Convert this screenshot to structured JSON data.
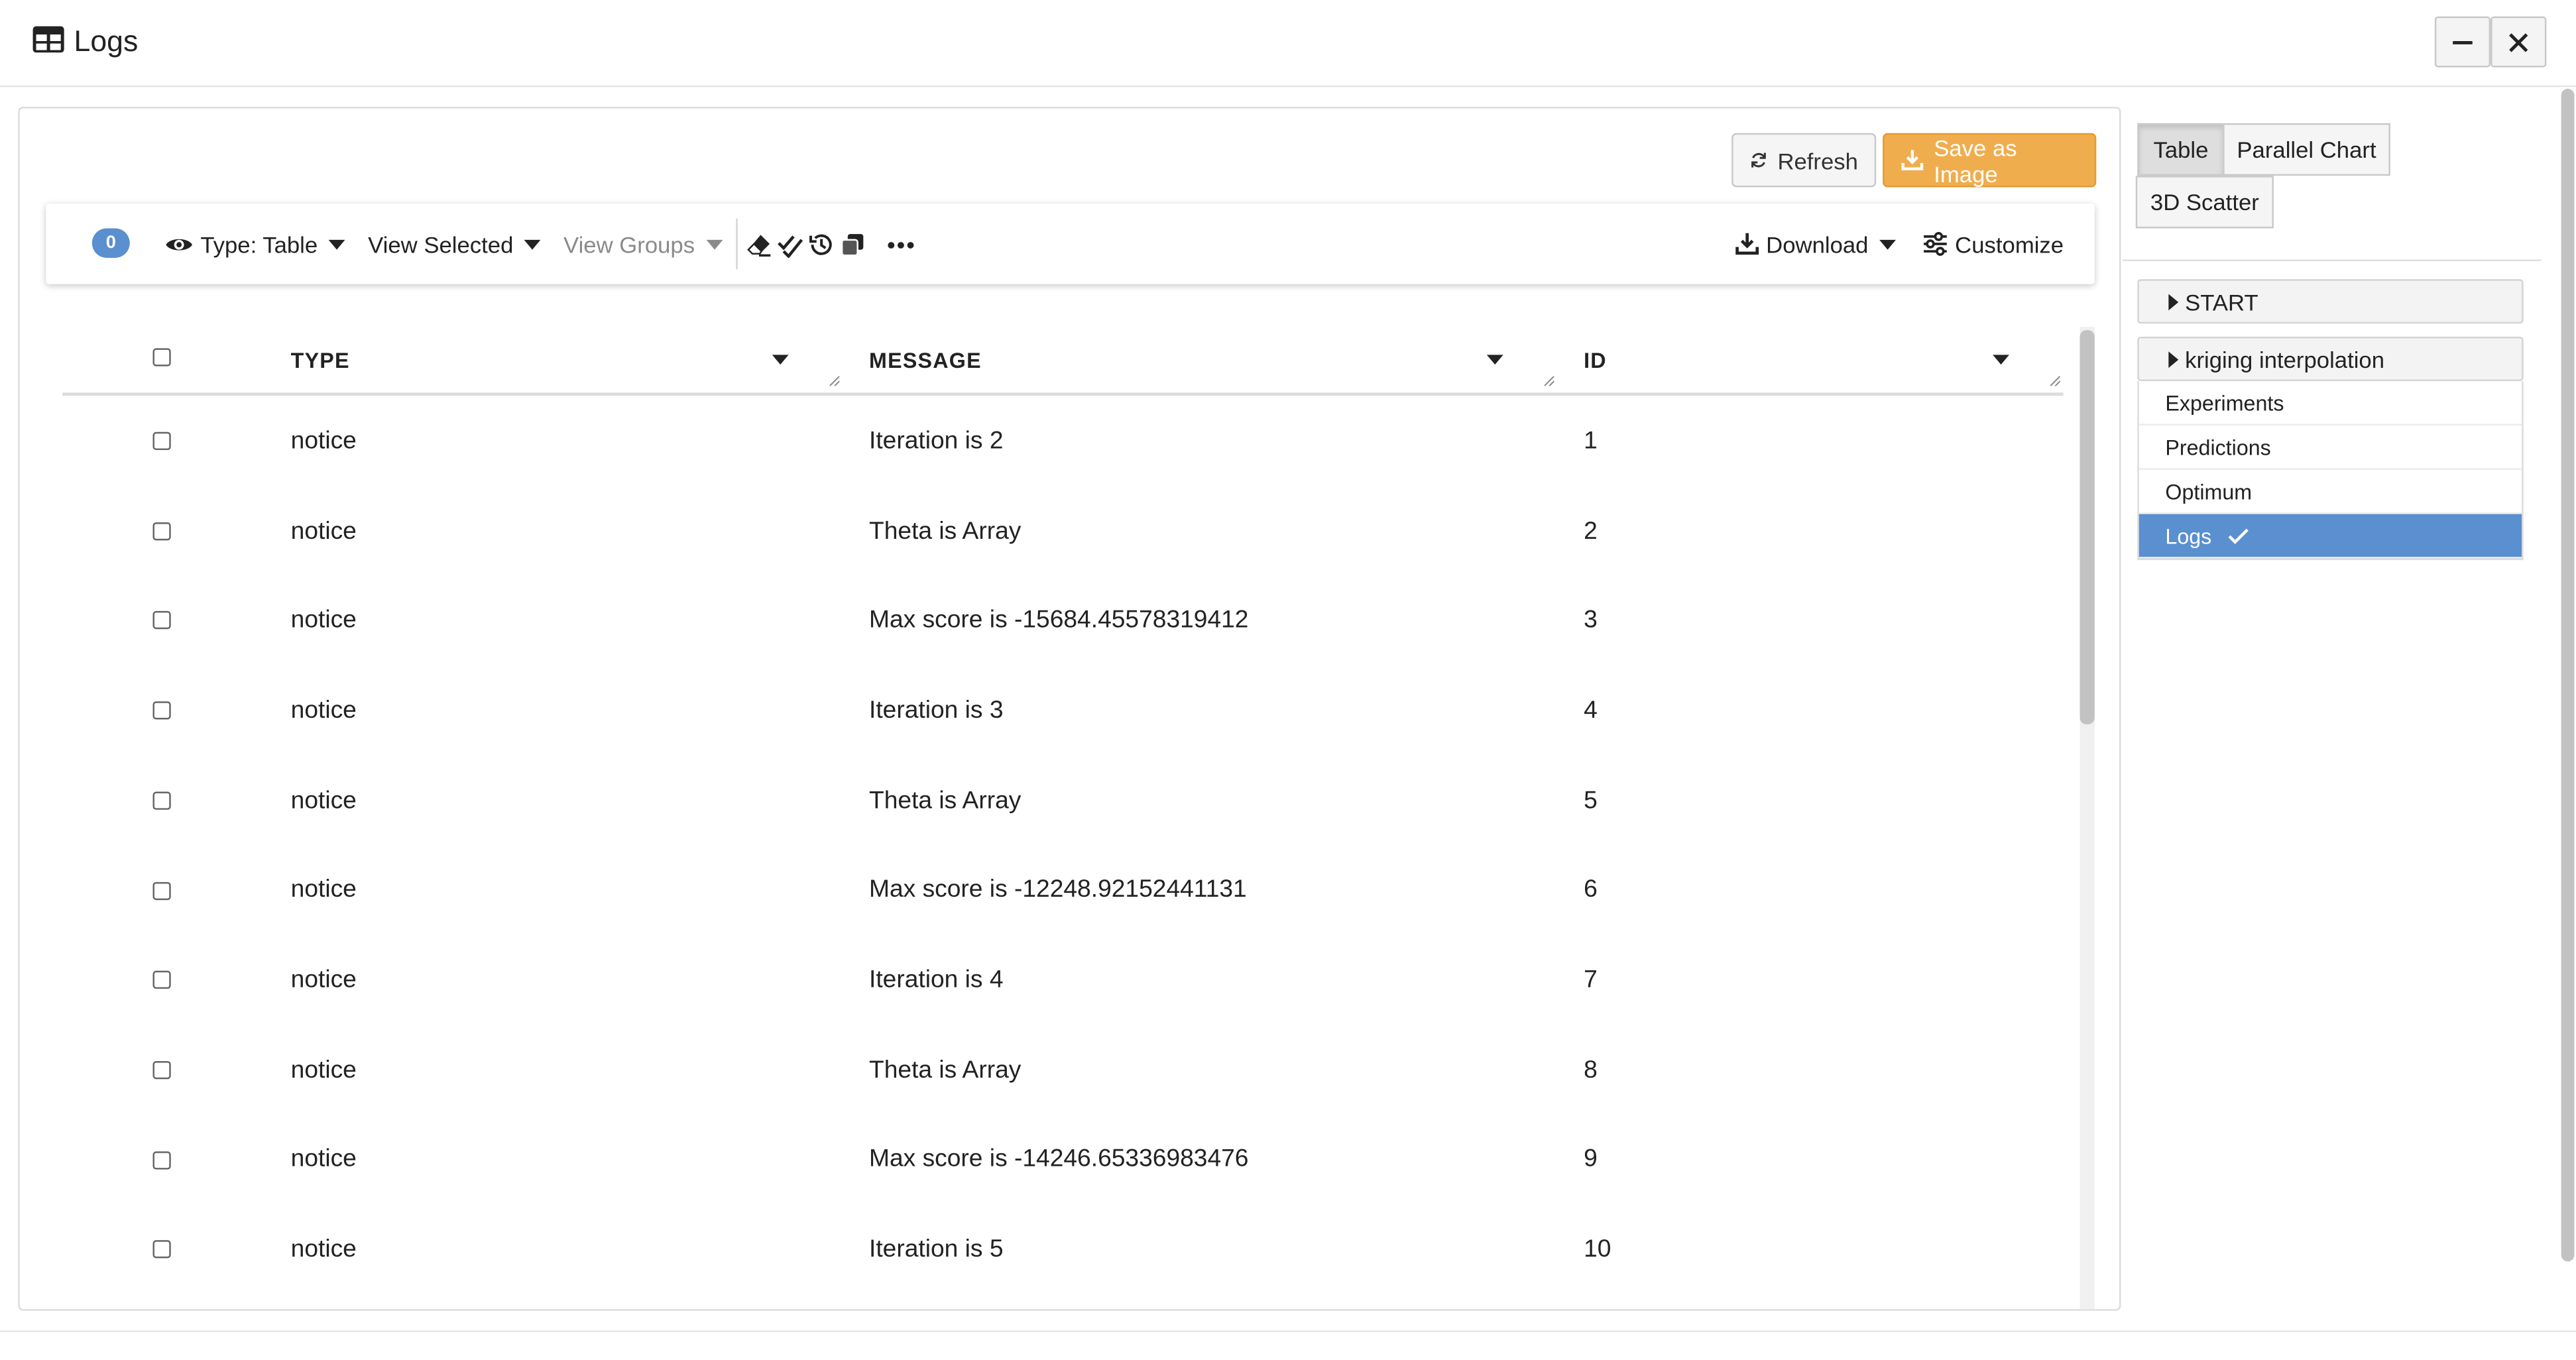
{
  "window": {
    "title": "Logs",
    "minimize_icon": "minus-icon",
    "close_icon": "close-icon"
  },
  "actions": {
    "refresh_label": "Refresh",
    "save_image_label": "Save as Image"
  },
  "toolbar": {
    "selected_count": "0",
    "type_label": "Type: Table",
    "view_selected_label": "View Selected",
    "view_groups_label": "View Groups",
    "download_label": "Download",
    "customize_label": "Customize",
    "more_label": "•••"
  },
  "grid": {
    "columns": [
      "TYPE",
      "MESSAGE",
      "ID"
    ],
    "rows": [
      {
        "type": "notice",
        "message": "Iteration is 2",
        "id": "1"
      },
      {
        "type": "notice",
        "message": "Theta is Array",
        "id": "2"
      },
      {
        "type": "notice",
        "message": "Max score is -15684.45578319412",
        "id": "3"
      },
      {
        "type": "notice",
        "message": "Iteration is 3",
        "id": "4"
      },
      {
        "type": "notice",
        "message": "Theta is Array",
        "id": "5"
      },
      {
        "type": "notice",
        "message": "Max score is -12248.92152441131",
        "id": "6"
      },
      {
        "type": "notice",
        "message": "Iteration is 4",
        "id": "7"
      },
      {
        "type": "notice",
        "message": "Theta is Array",
        "id": "8"
      },
      {
        "type": "notice",
        "message": "Max score is -14246.65336983476",
        "id": "9"
      },
      {
        "type": "notice",
        "message": "Iteration is 5",
        "id": "10"
      }
    ]
  },
  "view_tabs": {
    "table": "Table",
    "parallel_chart": "Parallel Chart",
    "scatter_3d": "3D Scatter"
  },
  "nav": {
    "start_label": "START",
    "kriging_label": "kriging interpolation",
    "items": [
      "Experiments",
      "Predictions",
      "Optimum",
      "Logs"
    ],
    "active_item": "Logs"
  },
  "colors": {
    "accent_blue": "#5a8fd0",
    "save_orange": "#f0ad4e"
  }
}
